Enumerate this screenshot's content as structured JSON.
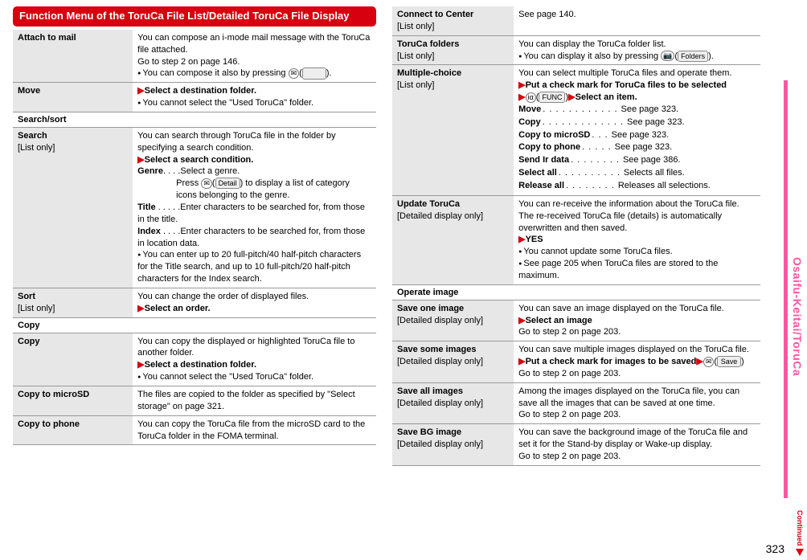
{
  "header": "Function Menu of the ToruCa File List/Detailed ToruCa File Display",
  "sidebar": "Osaifu-Keitai/ToruCa",
  "continued": "Continued",
  "pagenum": "323",
  "icons": {
    "mail": "✉",
    "cam": "📷",
    "ir": "iα",
    "detail": "Detail",
    "func": "FUNC",
    "folders": "Folders",
    "save": "Save",
    "blank": "     "
  },
  "left": {
    "r1": {
      "l": "Attach to mail",
      "t1": "You can compose an i-mode mail message with the ToruCa file attached.",
      "t2": "Go to step 2 on page 146.",
      "t3a": "You can compose it also by pressing ",
      "t3b": "(",
      "t3c": ")."
    },
    "r2": {
      "l": "Move",
      "s": "Select a destination folder.",
      "b": "You cannot select the \"Used ToruCa\" folder."
    },
    "g1": "Search/sort",
    "r3": {
      "l": "Search",
      "ls": "[List only]",
      "t1": "You can search through ToruCa file in the folder by specifying a search condition.",
      "s": "Select a search condition.",
      "d1k": "Genre",
      "d1v": "Select a genre.",
      "d1x1": "Press ",
      "d1x2": "(",
      "d1x3": ") to display a list of category icons belonging to the genre.",
      "d2k": "Title",
      "d2v": "Enter characters to be searched for, from those in the title.",
      "d3k": "Index",
      "d3v": "Enter characters to be searched for, from those in location data.",
      "b": "You can enter up to 20 full-pitch/40 half-pitch characters for the Title search, and up to 10 full-pitch/20 half-pitch characters for the Index search."
    },
    "r4": {
      "l": "Sort",
      "ls": "[List only]",
      "t": "You can change the order of displayed files.",
      "s": "Select an order."
    },
    "g2": "Copy",
    "r5": {
      "l": "Copy",
      "t": "You can copy the displayed or highlighted ToruCa file to another folder.",
      "s": "Select a destination folder.",
      "b": "You cannot select the \"Used ToruCa\" folder."
    },
    "r6": {
      "l": "Copy to microSD",
      "t": "The files are copied to the folder as specified by \"Select storage\" on page 321."
    },
    "r7": {
      "l": "Copy to phone",
      "t": "You can copy the ToruCa file from the microSD card to the ToruCa folder in the FOMA terminal."
    }
  },
  "right": {
    "r1": {
      "l": "Connect to Center",
      "ls": "[List only]",
      "t": "See page 140."
    },
    "r2": {
      "l": "ToruCa folders",
      "ls": "[List only]",
      "t": "You can display the ToruCa folder list.",
      "b1": "You can display it also by pressing ",
      "b2": "(",
      "b3": ")."
    },
    "r3": {
      "l": "Multiple-choice",
      "ls": "[List only]",
      "t": "You can select multiple ToruCa files and operate them.",
      "s1": "Put a check mark for ToruCa files to be selected",
      "s2a": "(",
      "s2b": ")",
      "s2c": "Select an item.",
      "items": [
        {
          "k": "Move",
          "d": ". . . . . . . . . . . .",
          "v": "See page 323."
        },
        {
          "k": "Copy",
          "d": ". . . . . . . . . . . . .",
          "v": "See page 323."
        },
        {
          "k": "Copy to microSD",
          "d": ". . .",
          "v": "See page 323."
        },
        {
          "k": "Copy to phone",
          "d": ". . . . .",
          "v": "See page 323."
        },
        {
          "k": "Send Ir data",
          "d": ". . . . . . . .",
          "v": "See page 386."
        },
        {
          "k": "Select all",
          "d": ". . . . . . . . . .",
          "v": "Selects all files."
        },
        {
          "k": "Release all",
          "d": ". . . . . . . .",
          "v": "Releases all selections."
        }
      ]
    },
    "r4": {
      "l": "Update ToruCa",
      "ls": "[Detailed display only]",
      "t": "You can re-receive the information about the ToruCa file. The re-received ToruCa file (details) is automatically overwritten and then saved.",
      "s": "YES",
      "b1": "You cannot update some ToruCa files.",
      "b2": "See page 205 when ToruCa files are stored to the maximum."
    },
    "g1": "Operate image",
    "r5": {
      "l": "Save one image",
      "ls": "[Detailed display only]",
      "t": "You can save an image displayed on the ToruCa file.",
      "s": "Select an image",
      "t2": "Go to step 2 on page 203."
    },
    "r6": {
      "l": "Save some images",
      "ls": "[Detailed display only]",
      "t": "You can save multiple images displayed on the ToruCa file.",
      "s": "Put a check mark for images to be saved",
      "i1": "(",
      "i2": ")",
      "t2": "Go to step 2 on page 203."
    },
    "r7": {
      "l": "Save all images",
      "ls": "[Detailed display only]",
      "t": "Among the images displayed on the ToruCa file, you can save all the images that can be saved at one time.",
      "t2": "Go to step 2 on page 203."
    },
    "r8": {
      "l": "Save BG image",
      "ls": "[Detailed display only]",
      "t": "You can save the background image of the ToruCa file and set it for the Stand-by display or Wake-up display.",
      "t2": "Go to step 2 on page 203."
    }
  }
}
